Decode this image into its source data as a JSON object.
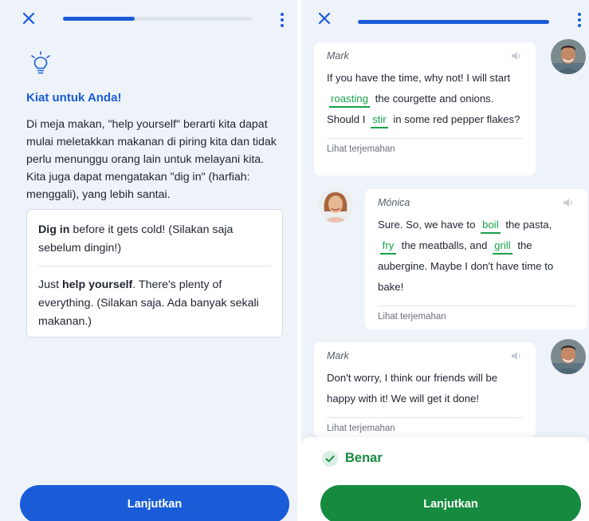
{
  "left": {
    "progress_fraction": 0.38,
    "tips": {
      "title": "Kiat untuk Anda!",
      "body": "Di meja makan, \"help yourself\" berarti kita dapat mulai meletakkan makanan di piring kita dan tidak perlu menunggu orang lain untuk melayani kita. Kita juga dapat mengatakan \"dig in\" (harfiah: menggali), yang lebih santai."
    },
    "examples": [
      {
        "bold": "Dig in",
        "rest": " before it gets cold! (Silakan saja sebelum dingin!)"
      },
      {
        "pre": "Just ",
        "bold": "help yourself",
        "rest": ". There's plenty of everything. (Silakan saja. Ada banyak sekali makanan.)"
      }
    ],
    "continue_label": "Lanjutkan"
  },
  "right": {
    "progress_fraction": 1.0,
    "messages": [
      {
        "name": "Mark",
        "p1": "If you have the time, why not! I will start",
        "blank1": "roasting",
        "p2": "the courgette and onions. Should I",
        "blank2": "stir",
        "p3": "in some red pepper flakes?",
        "translate": "Lihat terjemahan"
      },
      {
        "name": "Mónica",
        "p1": "Sure. So, we have to",
        "blank1": "boil",
        "p2": "the pasta,",
        "blank2": "fry",
        "p3": "the meatballs, and",
        "blank3": "grill",
        "p4": "the aubergine. Maybe I don't have time to bake!",
        "translate": "Lihat terjemahan"
      },
      {
        "name": "Mark",
        "text": "Don't worry, I think our friends will be happy with it! We will get it done!",
        "translate": "Lihat terjemahan"
      }
    ],
    "result": {
      "label": "Benar"
    },
    "continue_label": "Lanjutkan"
  },
  "colors": {
    "primary_blue": "#1a5cd8",
    "success_green": "#168a3f",
    "blank_green": "#17a24a",
    "background": "#eef3fa"
  },
  "icons": [
    "close-icon",
    "kebab-menu-icon",
    "lightbulb-icon",
    "speaker-icon",
    "check-circle-icon"
  ]
}
